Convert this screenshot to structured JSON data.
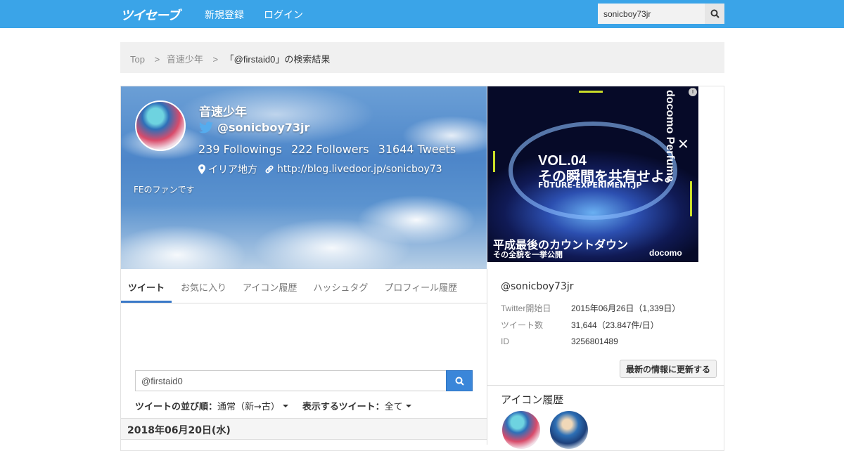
{
  "navbar": {
    "logo": "ツイセーブ",
    "signup": "新規登録",
    "login": "ログイン",
    "search_value": "sonicboy73jr"
  },
  "breadcrumb": {
    "items": [
      "Top",
      "音速少年"
    ],
    "current": "「@firstaid0」の検索結果"
  },
  "profile": {
    "name": "音速少年",
    "handle": "@sonicboy73jr",
    "followings": "239 Followings",
    "followers": "222 Followers",
    "tweets": "31644 Tweets",
    "location": "イリア地方",
    "url": "http://blog.livedoor.jp/sonicboy73",
    "bio": "FEのファンです"
  },
  "tabs": [
    {
      "label": "ツイート",
      "active": true
    },
    {
      "label": "お気に入り"
    },
    {
      "label": "アイコン履歴"
    },
    {
      "label": "ハッシュタグ"
    },
    {
      "label": "プロフィール履歴"
    }
  ],
  "tweet_search": {
    "value": "@firstaid0"
  },
  "sort": {
    "order_label": "ツイートの並び順：",
    "order_value": "通常（新→古）",
    "filter_label": "表示するツイート：",
    "filter_value": "全て"
  },
  "date_header": "2018年06月20日(水)",
  "ad": {
    "vol": "VOL.04",
    "headline": "その瞬間を共有せよ。",
    "sub": "FUTURE-EXPERIMENT.JP",
    "bottom1": "平成最後のカウントダウン",
    "bottom2": "その全貌を一挙公開",
    "brand": "docomo",
    "vertical": "docomo Perfume",
    "info": "i"
  },
  "sidebar": {
    "handle": "@sonicboy73jr",
    "info": [
      {
        "key": "Twitter開始日",
        "value": "2015年06月26日（1,339日）"
      },
      {
        "key": "ツイート数",
        "value": "31,644（23.847件/日）"
      },
      {
        "key": "ID",
        "value": "3256801489"
      }
    ],
    "refresh_label": "最新の情報に更新する",
    "icon_history_title": "アイコン履歴"
  },
  "colors": {
    "navbar": "#3aa4e8",
    "accent": "#3a86d9"
  }
}
